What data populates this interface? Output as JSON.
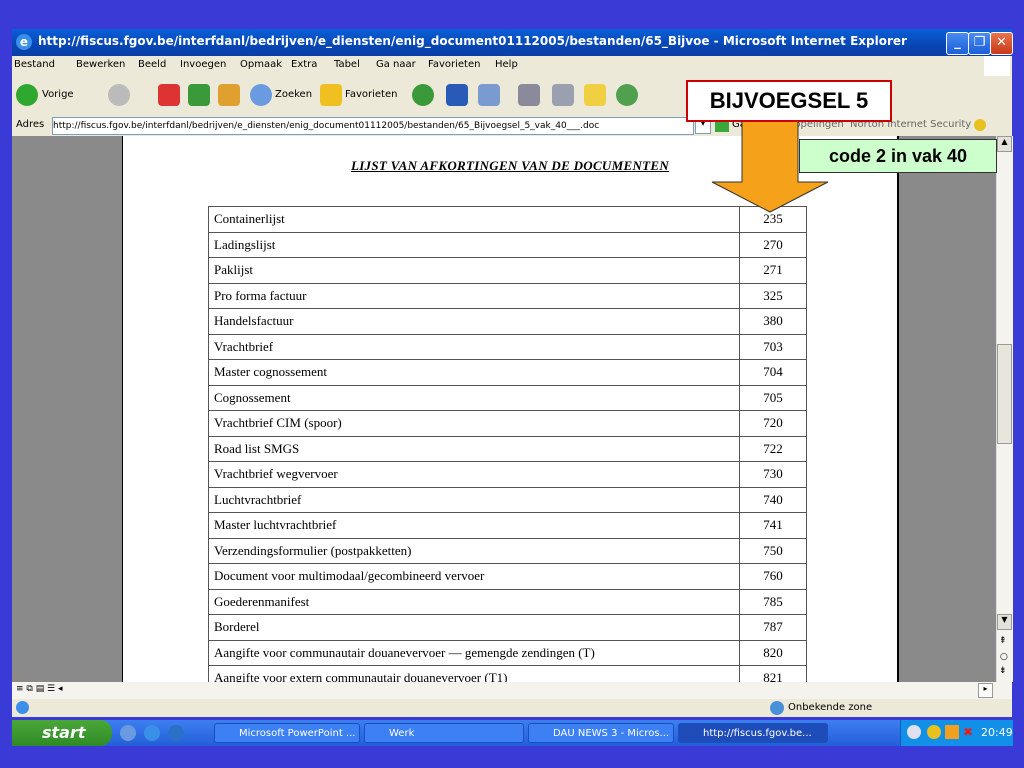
{
  "window": {
    "title": "http://fiscus.fgov.be/interfdanl/bedrijven/e_diensten/enig_document01112005/bestanden/65_Bijvoe - Microsoft Internet Explorer"
  },
  "menu": [
    "Bestand",
    "Bewerken",
    "Beeld",
    "Invoegen",
    "Opmaak",
    "Extra",
    "Tabel",
    "Ga naar",
    "Favorieten",
    "Help"
  ],
  "toolbar": {
    "back_label": "Vorige",
    "search_label": "Zoeken",
    "favorites_label": "Favorieten"
  },
  "address": {
    "label": "Adres",
    "url": "http://fiscus.fgov.be/interfdanl/bedrijven/e_diensten/enig_document01112005/bestanden/65_Bijvoegsel_5_vak_40___.doc",
    "go_label": "Ga naar",
    "links_label": "Koppelingen",
    "security_label": "Norton Internet Security"
  },
  "document": {
    "title": "LIJST VAN AFKORTINGEN VAN DE DOCUMENTEN",
    "rows": [
      {
        "name": "Containerlijst",
        "code": "235"
      },
      {
        "name": "Ladingslijst",
        "code": "270"
      },
      {
        "name": "Paklijst",
        "code": "271"
      },
      {
        "name": "Pro forma factuur",
        "code": "325"
      },
      {
        "name": "Handelsfactuur",
        "code": "380"
      },
      {
        "name": "Vrachtbrief",
        "code": "703"
      },
      {
        "name": "Master cognossement",
        "code": "704"
      },
      {
        "name": "Cognossement",
        "code": "705"
      },
      {
        "name": "Vrachtbrief CIM (spoor)",
        "code": "720"
      },
      {
        "name": "Road list SMGS",
        "code": "722"
      },
      {
        "name": "Vrachtbrief wegvervoer",
        "code": "730"
      },
      {
        "name": "Luchtvrachtbrief",
        "code": "740"
      },
      {
        "name": "Master luchtvrachtbrief",
        "code": "741"
      },
      {
        "name": "Verzendingsformulier (postpakketten)",
        "code": "750"
      },
      {
        "name": "Document voor multimodaal/gecombineerd vervoer",
        "code": "760"
      },
      {
        "name": "Goederenmanifest",
        "code": "785"
      },
      {
        "name": "Borderel",
        "code": "787"
      },
      {
        "name": "Aangifte voor communautair douanevervoer — gemengde zendingen (T)",
        "code": "820"
      },
      {
        "name": "Aangifte voor extern communautair douanevervoer (T1)",
        "code": "821"
      }
    ]
  },
  "status": {
    "zone": "Onbekende zone"
  },
  "taskbar": {
    "start_label": "start",
    "items": [
      "Microsoft PowerPoint ...",
      "Werk",
      "DAU NEWS 3 - Micros...",
      "http://fiscus.fgov.be..."
    ],
    "clock": "20:49"
  },
  "annotations": {
    "bijvoegsel": "BIJVOEGSEL 5",
    "code_box": "code 2 in vak 40"
  },
  "colors": {
    "arrow": "#f5a11a",
    "code_box_bg": "#ccffcc",
    "bijvoegsel_border": "#cc0000"
  }
}
